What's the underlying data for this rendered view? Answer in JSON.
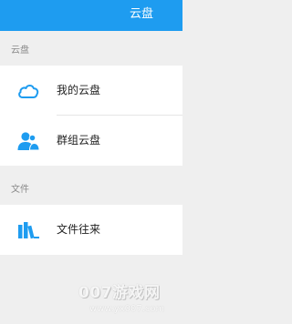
{
  "header": {
    "title": "云盘"
  },
  "sections": [
    {
      "label": "云盘",
      "items": [
        {
          "label": "我的云盘",
          "icon": "cloud-icon"
        },
        {
          "label": "群组云盘",
          "icon": "group-users-icon"
        }
      ]
    },
    {
      "label": "文件",
      "items": [
        {
          "label": "文件往来",
          "icon": "books-icon"
        }
      ]
    }
  ],
  "watermark": {
    "text": "007游戏网",
    "url": "www.yx007.com"
  },
  "colors": {
    "accent": "#1e9cf0",
    "background": "#efefef"
  }
}
